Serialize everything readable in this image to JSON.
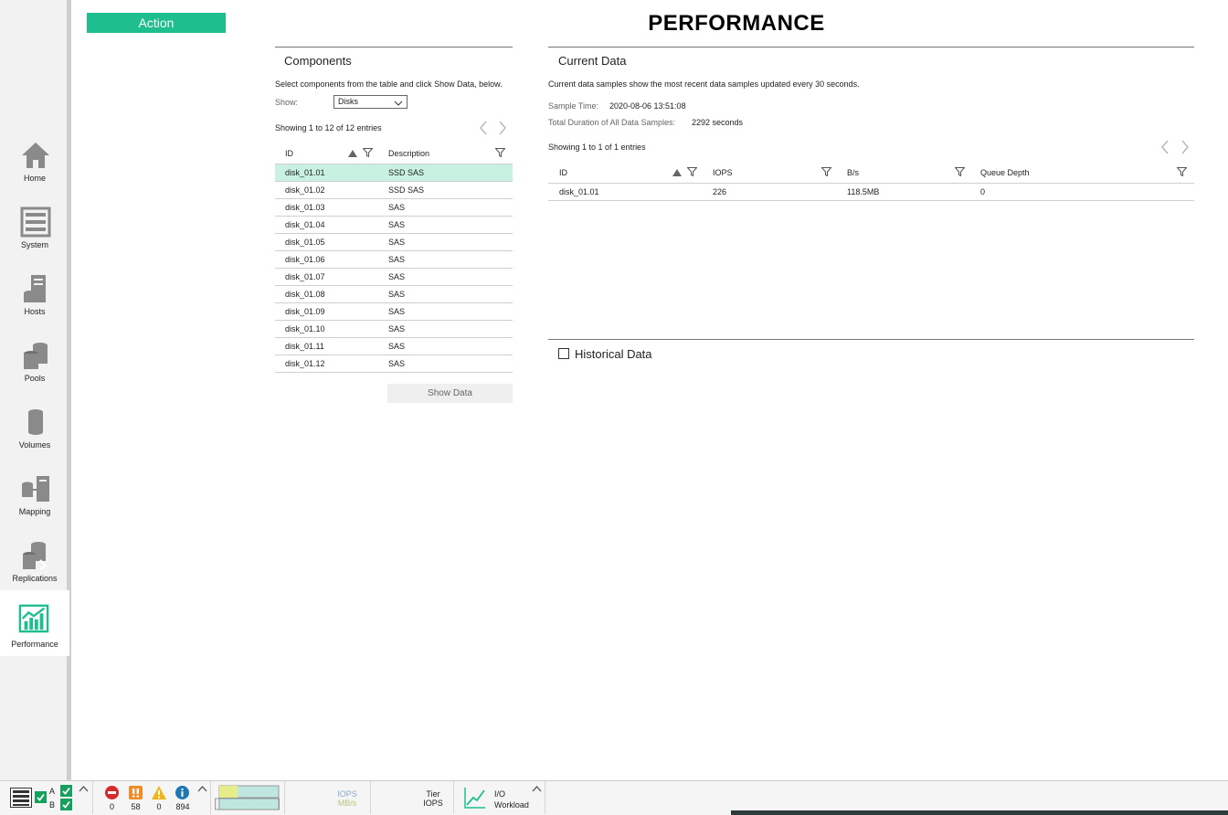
{
  "page": {
    "title": "PERFORMANCE"
  },
  "action": {
    "label": "Action"
  },
  "sidebar": {
    "items": [
      {
        "label": "Home",
        "icon": "home-icon"
      },
      {
        "label": "System",
        "icon": "system-icon"
      },
      {
        "label": "Hosts",
        "icon": "hosts-icon"
      },
      {
        "label": "Pools",
        "icon": "pools-icon"
      },
      {
        "label": "Volumes",
        "icon": "volumes-icon"
      },
      {
        "label": "Mapping",
        "icon": "mapping-icon"
      },
      {
        "label": "Replications",
        "icon": "replications-icon"
      },
      {
        "label": "Performance",
        "icon": "performance-icon",
        "active": true
      }
    ]
  },
  "components": {
    "title": "Components",
    "instructions": "Select components from the table and click Show Data, below.",
    "show_label": "Show:",
    "show_value": "Disks",
    "entries": "Showing 1 to 12 of 12 entries",
    "columns": [
      "ID",
      "Description"
    ],
    "rows": [
      {
        "id": "disk_01.01",
        "desc": "SSD SAS"
      },
      {
        "id": "disk_01.02",
        "desc": "SSD SAS"
      },
      {
        "id": "disk_01.03",
        "desc": "SAS"
      },
      {
        "id": "disk_01.04",
        "desc": "SAS"
      },
      {
        "id": "disk_01.05",
        "desc": "SAS"
      },
      {
        "id": "disk_01.06",
        "desc": "SAS"
      },
      {
        "id": "disk_01.07",
        "desc": "SAS"
      },
      {
        "id": "disk_01.08",
        "desc": "SAS"
      },
      {
        "id": "disk_01.09",
        "desc": "SAS"
      },
      {
        "id": "disk_01.10",
        "desc": "SAS"
      },
      {
        "id": "disk_01.11",
        "desc": "SAS"
      },
      {
        "id": "disk_01.12",
        "desc": "SAS"
      }
    ],
    "show_data_label": "Show Data"
  },
  "current": {
    "title": "Current Data",
    "description": "Current data samples show the most recent data samples updated every 30 seconds.",
    "sample_time_label": "Sample Time:",
    "sample_time": "2020-08-06 13:51:08",
    "duration_label": "Total Duration of All Data Samples:",
    "duration": "2292 seconds",
    "entries": "Showing 1 to 1 of 1 entries",
    "columns": [
      "ID",
      "IOPS",
      "B/s",
      "Queue Depth"
    ],
    "rows": [
      {
        "id": "disk_01.01",
        "iops": "226",
        "bps": "118.5MB",
        "queue": "0"
      }
    ]
  },
  "historical": {
    "label": "Historical Data"
  },
  "statusbar": {
    "controller_a": "A",
    "controller_b": "B",
    "counts": {
      "critical": "0",
      "error": "58",
      "warning": "0",
      "info": "894"
    },
    "iops_label": "IOPS",
    "mbs_label": "MB/s",
    "tier_label_1": "Tier",
    "tier_label_2": "IOPS",
    "io_label_1": "I/O",
    "io_label_2": "Workload"
  },
  "colors": {
    "accent": "#1ebe8e",
    "selected_row": "#c9f1e2",
    "icon_gray": "#8a8a8a"
  }
}
